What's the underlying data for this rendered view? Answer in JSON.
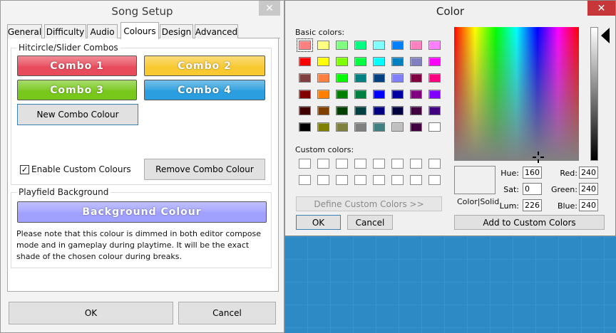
{
  "song_setup": {
    "title": "Song Setup",
    "close_glyph": "✕",
    "tabs": [
      {
        "label": "General"
      },
      {
        "label": "Difficulty"
      },
      {
        "label": "Audio"
      },
      {
        "label": "Colours",
        "active": true
      },
      {
        "label": "Design"
      },
      {
        "label": "Advanced"
      }
    ],
    "combos_group": {
      "label": "Hitcircle/Slider Combos",
      "combos": [
        {
          "label": "Combo 1",
          "color": "#e84c5c"
        },
        {
          "label": "Combo 2",
          "color": "#f8c930"
        },
        {
          "label": "Combo 3",
          "color": "#78c81c"
        },
        {
          "label": "Combo 4",
          "color": "#2a9ede"
        }
      ],
      "new_combo_label": "New Combo Colour",
      "enable_custom_label": "Enable Custom Colours",
      "enable_custom_checked": true,
      "remove_combo_label": "Remove Combo Colour"
    },
    "background_group": {
      "label": "Playfield Background",
      "button_label": "Background Colour",
      "button_color": "#a0a0ff",
      "note": "Please note that this colour is dimmed in both editor compose mode and in gameplay during playtime.  It will be the exact shade of the chosen colour during breaks."
    },
    "ok_label": "OK",
    "cancel_label": "Cancel"
  },
  "color_dialog": {
    "title": "Color",
    "close_glyph": "✕",
    "basic_colors_label": "Basic colors:",
    "basic_colors": [
      "#ff8080",
      "#ffff80",
      "#80ff80",
      "#00ff80",
      "#80ffff",
      "#0080ff",
      "#ff80c0",
      "#ff80ff",
      "#ff0000",
      "#ffff00",
      "#80ff00",
      "#00ff40",
      "#00ffff",
      "#0080c0",
      "#8080c0",
      "#ff00ff",
      "#804040",
      "#ff8040",
      "#00ff00",
      "#008080",
      "#004080",
      "#8080ff",
      "#800040",
      "#ff0080",
      "#800000",
      "#ff8000",
      "#008000",
      "#008040",
      "#0000ff",
      "#0000a0",
      "#800080",
      "#8000ff",
      "#400000",
      "#804000",
      "#004000",
      "#004040",
      "#000080",
      "#000040",
      "#400040",
      "#400080",
      "#000000",
      "#808000",
      "#808040",
      "#808080",
      "#408080",
      "#c0c0c0",
      "#400040",
      "#ffffff"
    ],
    "custom_colors_label": "Custom colors:",
    "define_custom_label": "Define Custom Colors >>",
    "ok_label": "OK",
    "cancel_label": "Cancel",
    "color_solid_label": "Color|Solid",
    "hue_label": "Hue:",
    "hue": "160",
    "sat_label": "Sat:",
    "sat": "0",
    "lum_label": "Lum:",
    "lum": "226",
    "red_label": "Red:",
    "red": "240",
    "green_label": "Green:",
    "green": "240",
    "blue_label": "Blue:",
    "blue": "240",
    "add_custom_label": "Add to Custom Colors",
    "current_color": "#f0f0f0"
  }
}
